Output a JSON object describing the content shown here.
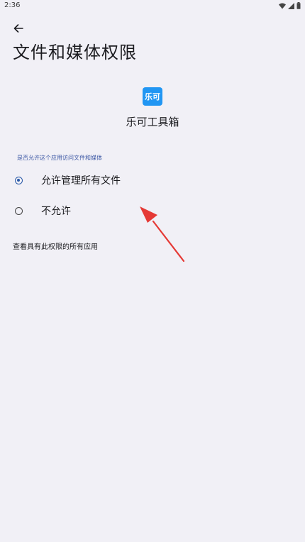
{
  "status_bar": {
    "time": "2:36"
  },
  "header": {
    "back_icon": "arrow-back-icon",
    "title": "文件和媒体权限"
  },
  "app": {
    "icon_text": "乐可",
    "name": "乐可工具箱",
    "icon_color": "#2196f3"
  },
  "permission": {
    "section_label": "是否允许这个应用访问文件和媒体",
    "options": [
      {
        "label": "允许管理所有文件",
        "selected": true
      },
      {
        "label": "不允许",
        "selected": false
      }
    ]
  },
  "footer_link": {
    "label": "查看具有此权限的所有应用"
  },
  "colors": {
    "background": "#f1f0f6",
    "accent": "#2a5aa8",
    "annotation": "#e53935"
  }
}
